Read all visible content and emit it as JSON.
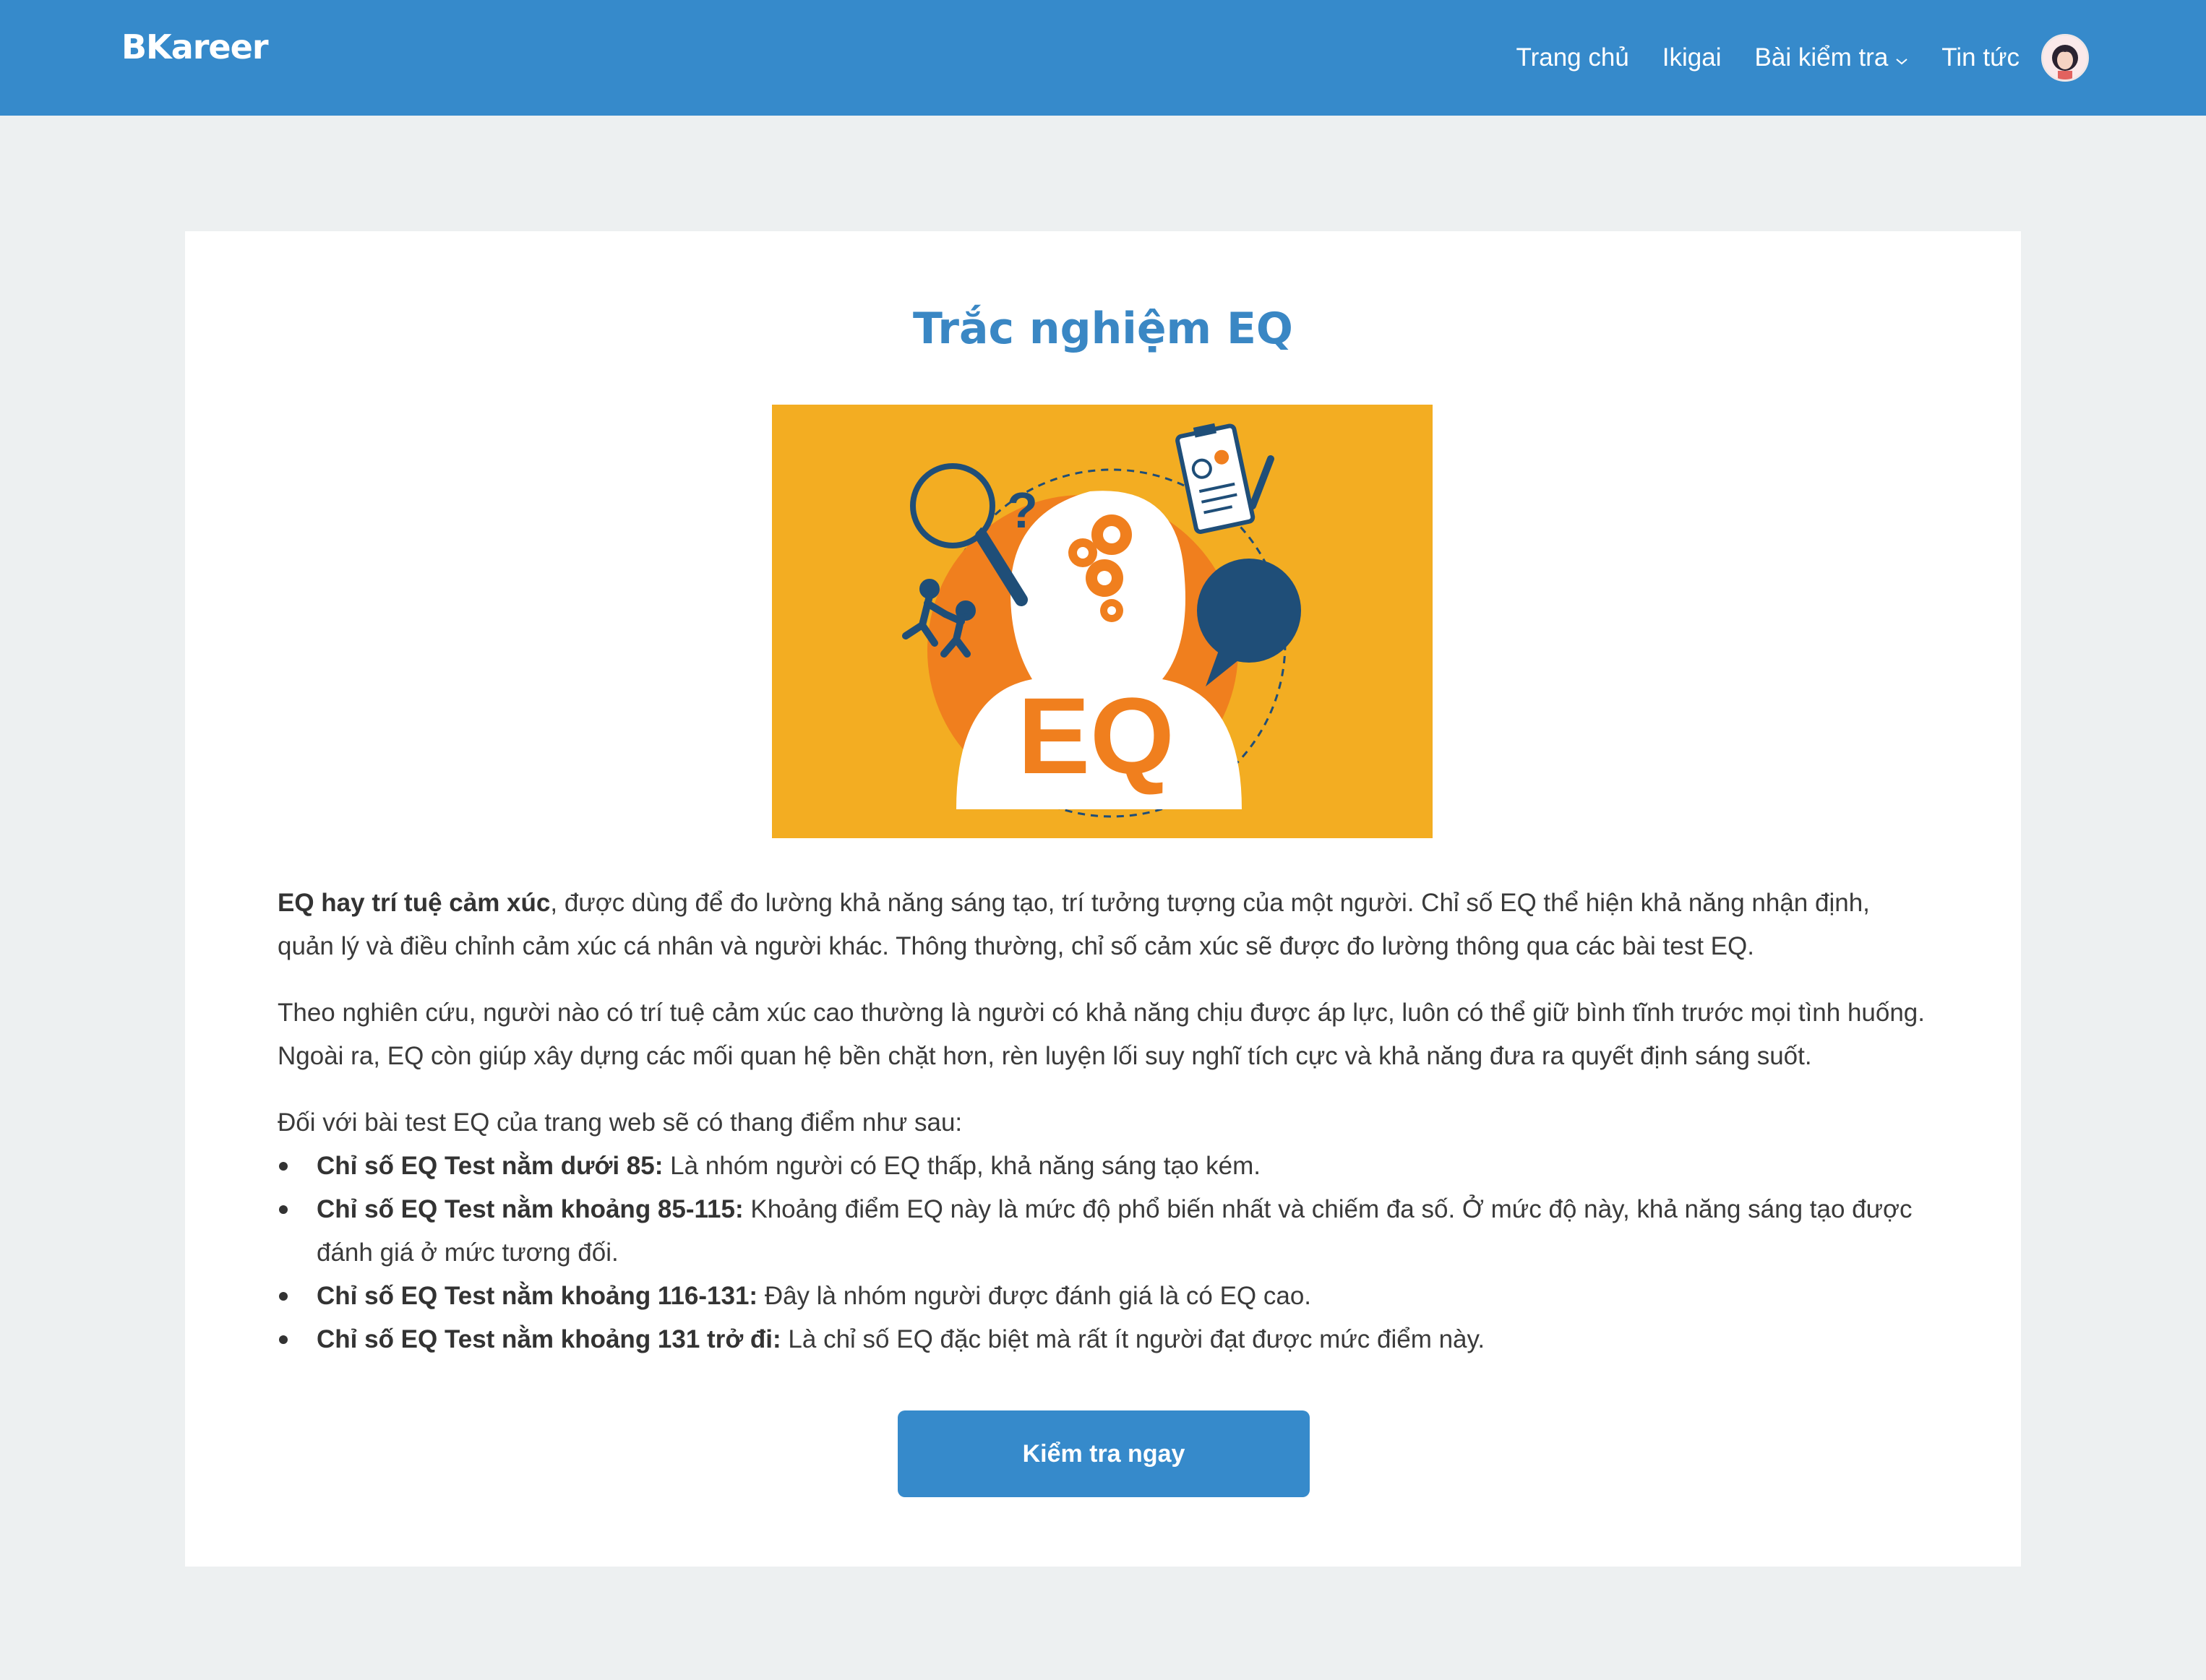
{
  "header": {
    "brand": "BKareer",
    "nav": [
      {
        "label": "Trang chủ"
      },
      {
        "label": "Ikigai"
      },
      {
        "label": "Bài kiểm tra"
      },
      {
        "label": "Tin tức"
      }
    ]
  },
  "main": {
    "title": "Trắc nghiệm EQ",
    "hero_image_text": "EQ",
    "intro": {
      "bold": "EQ hay trí tuệ cảm xúc",
      "text": ", được dùng để đo lường khả năng sáng tạo, trí tưởng tượng của một người. Chỉ số EQ thể hiện khả năng nhận định, quản lý và điều chỉnh cảm xúc cá nhân và người khác. Thông thường, chỉ số cảm xúc sẽ được đo lường thông qua các bài test EQ."
    },
    "paragraph2": "Theo nghiên cứu, người nào có trí tuệ cảm xúc cao thường là người có khả năng chịu được áp lực, luôn có thể giữ bình tĩnh trước mọi tình huống. Ngoài ra, EQ còn giúp xây dựng các mối quan hệ bền chặt hơn, rèn luyện lối suy nghĩ tích cực và khả năng đưa ra quyết định sáng suốt.",
    "scale_intro": "Đối với bài test EQ của trang web sẽ có thang điểm như sau:",
    "scale": [
      {
        "bold": "Chỉ số EQ Test nằm dưới 85:",
        "text": " Là nhóm người có EQ thấp, khả năng sáng tạo kém."
      },
      {
        "bold": "Chỉ số EQ Test nằm khoảng 85-115:",
        "text": " Khoảng điểm EQ này là mức độ phổ biến nhất và chiếm đa số. Ở mức độ này, khả năng sáng tạo được đánh giá ở mức tương đối."
      },
      {
        "bold": "Chỉ số EQ Test nằm khoảng 116-131:",
        "text": " Đây là nhóm người được đánh giá là có EQ cao."
      },
      {
        "bold": "Chỉ số EQ Test nằm khoảng 131 trở đi:",
        "text": " Là chỉ số EQ đặc biệt mà rất ít người đạt được mức điểm này."
      }
    ],
    "cta_label": "Kiểm tra ngay"
  },
  "colors": {
    "header": "#368acb",
    "title": "#3a87c4",
    "hero_bg": "#f3ad22",
    "hero_accent": "#f07f1e",
    "hero_navy": "#1f4e78"
  }
}
